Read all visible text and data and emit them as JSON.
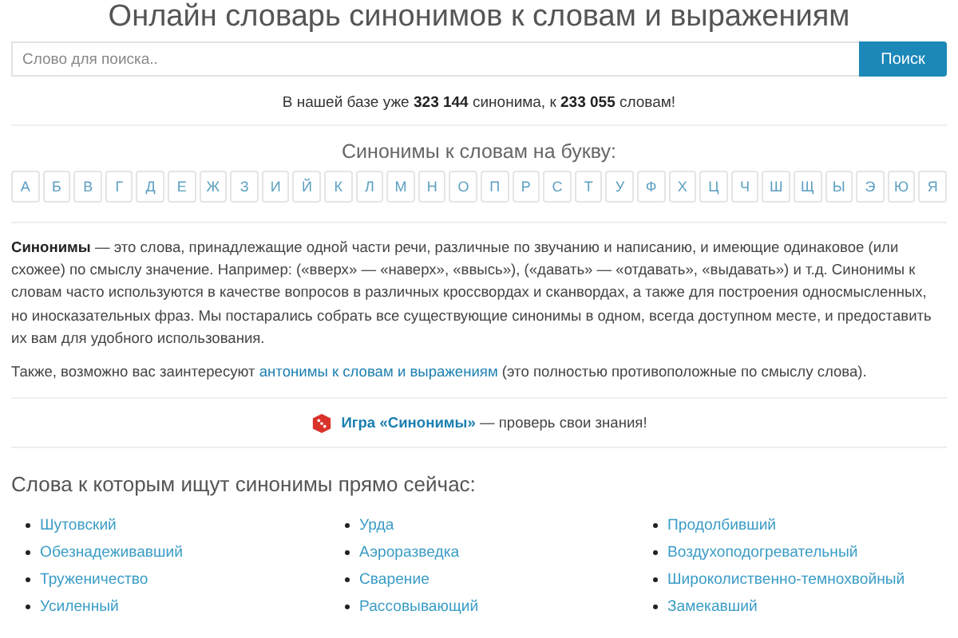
{
  "title": "Онлайн словарь синонимов к словам и выражениям",
  "search": {
    "placeholder": "Слово для поиска..",
    "button": "Поиск"
  },
  "stats": "В нашей базе уже **323 144** синонима, к **233 055** словам!",
  "alphabet": {
    "heading": "Синонимы к словам на букву:",
    "letters": [
      "А",
      "Б",
      "В",
      "Г",
      "Д",
      "Е",
      "Ж",
      "З",
      "И",
      "Й",
      "К",
      "Л",
      "М",
      "Н",
      "О",
      "П",
      "Р",
      "С",
      "Т",
      "У",
      "Ф",
      "Х",
      "Ц",
      "Ч",
      "Ш",
      "Щ",
      "Ы",
      "Э",
      "Ю",
      "Я"
    ]
  },
  "intro": "**Синонимы** — это слова, принадлежащие одной части речи, различные по звучанию и написанию, и имеющие одинаковое (или схожее) по смыслу значение. Например: («вверх» — «наверх», «ввысь»), («давать» — «отдавать», «выдавать») и т.д. Синонимы к словам часто используются в качестве вопросов в различных кроссвордах и сканвордах, а также для построения односмысленных, но иносказательных фраз. Мы постарались собрать все существующие синонимы в одном, всегда доступном месте, и предоставить их вам для удобного использования.",
  "also": {
    "before": "Также, возможно вас заинтересуют ",
    "link": "антонимы к словам и выражениям",
    "after": " (это полностью противоположные по смыслу слова)."
  },
  "game": {
    "link": "Игра «Синонимы»",
    "after": " — проверь свои знания!"
  },
  "popular": {
    "heading": "Слова к которым ищут синонимы прямо сейчас:",
    "columns": [
      [
        "Шутовский",
        "Обезнадеживавший",
        "Труженичество",
        "Усиленный"
      ],
      [
        "Урда",
        "Аэроразведка",
        "Сварение",
        "Рассовывающий"
      ],
      [
        "Продолбивший",
        "Воздухоподогревательный",
        "Широколиственно-темнохвойный",
        "Замекавший"
      ]
    ]
  }
}
